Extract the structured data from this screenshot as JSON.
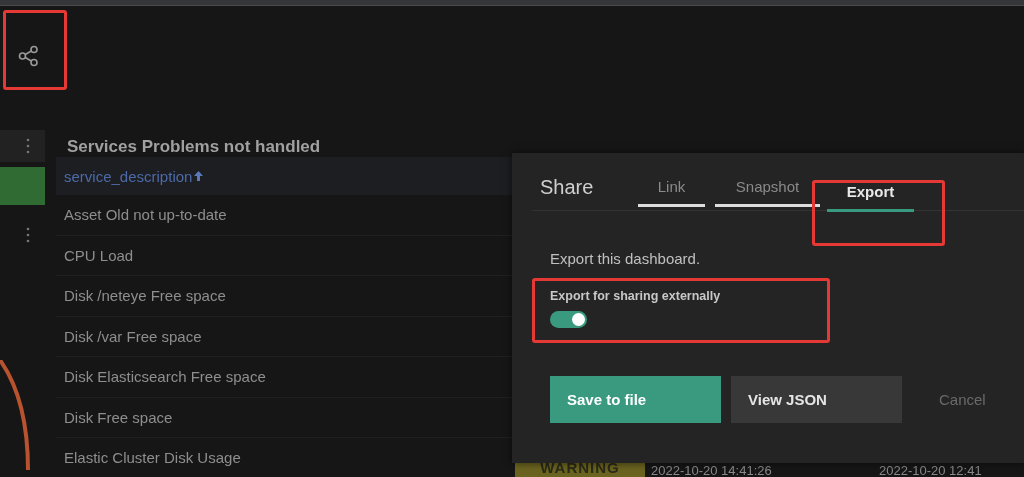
{
  "toolbar": {
    "share_highlighted": true
  },
  "table": {
    "title": "Services Problems not handled",
    "sort_column": {
      "label": "service_description",
      "ascending": true
    },
    "rows": [
      {
        "cells": [
          "Asset Old not up-to-date"
        ]
      },
      {
        "cells": [
          "CPU Load"
        ]
      },
      {
        "cells": [
          "Disk /neteye Free space"
        ]
      },
      {
        "cells": [
          "Disk /var Free space"
        ]
      },
      {
        "cells": [
          "Disk Elasticsearch Free space"
        ]
      },
      {
        "cells": [
          "Disk Free space"
        ]
      },
      {
        "cells": [
          "Elastic Cluster Disk Usage",
          "WARNING",
          "2022-10-20 14:41:26",
          "2022-10-20 12:41"
        ]
      }
    ]
  },
  "dialog": {
    "title": "Share",
    "tabs": [
      {
        "label": "Link",
        "selected": false,
        "highlighted": false
      },
      {
        "label": "Snapshot",
        "selected": false,
        "highlighted": false
      },
      {
        "label": "Export",
        "selected": true,
        "highlighted": true
      }
    ],
    "description": "Export this dashboard.",
    "option": {
      "label": "Export for sharing externally",
      "on": true,
      "highlighted": true
    },
    "buttons": [
      {
        "label": "Save to file",
        "kind": "primary"
      },
      {
        "label": "View JSON",
        "kind": "secondary"
      },
      {
        "label": "Cancel",
        "kind": "link"
      }
    ]
  }
}
